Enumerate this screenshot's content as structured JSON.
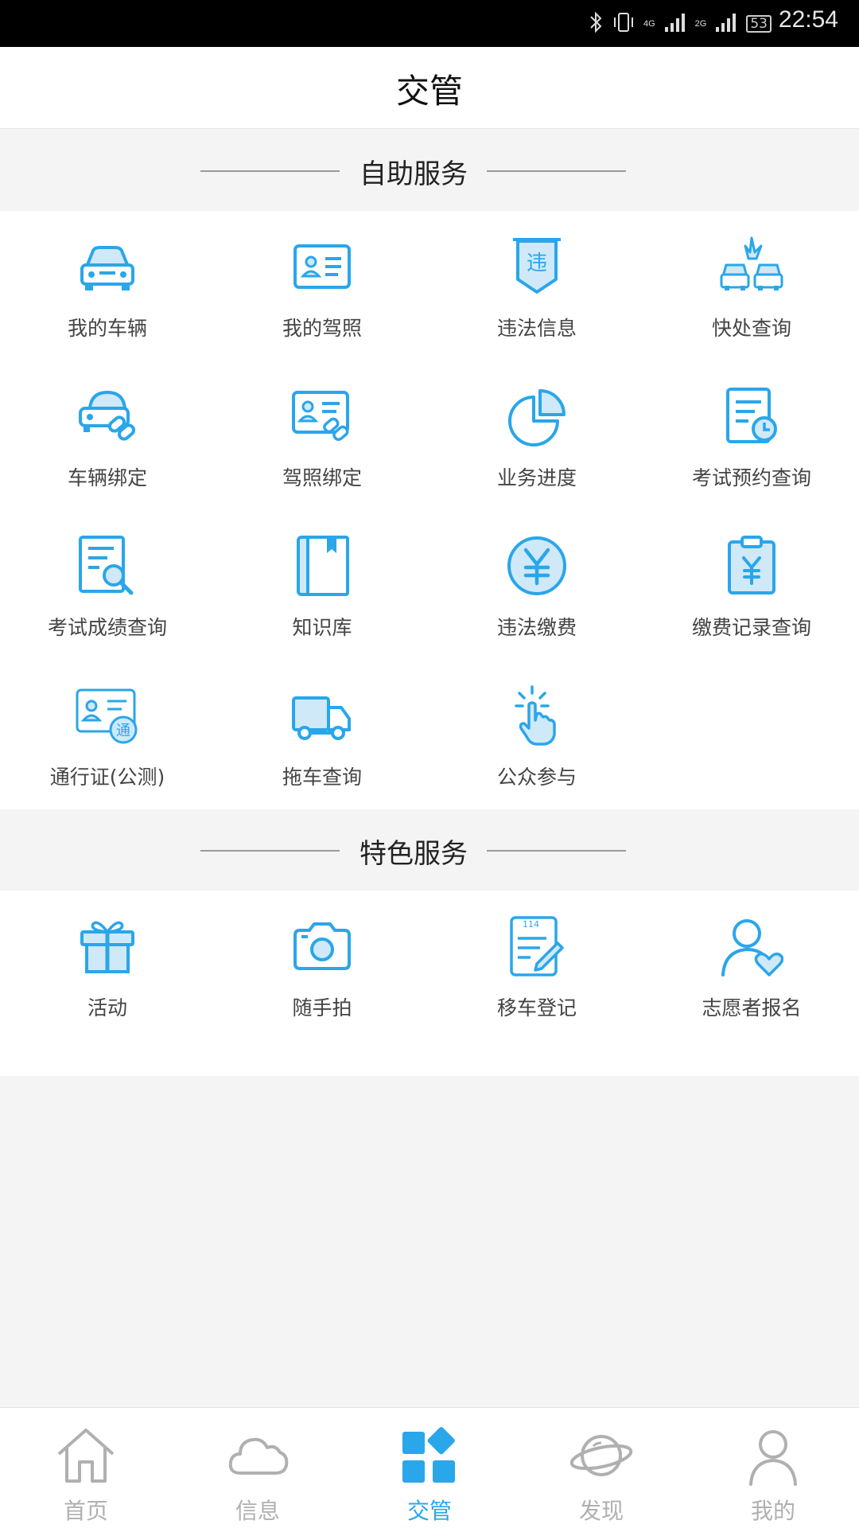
{
  "status_bar": {
    "network_4g": "4G",
    "network_2g": "2G",
    "battery": "53",
    "time": "22:54"
  },
  "app_bar": {
    "title": "交管"
  },
  "sections": {
    "self_service": {
      "title": "自助服务",
      "items": [
        {
          "label": "我的车辆",
          "icon": "car-icon"
        },
        {
          "label": "我的驾照",
          "icon": "license-card-icon"
        },
        {
          "label": "违法信息",
          "icon": "violation-badge-icon"
        },
        {
          "label": "快处查询",
          "icon": "car-collision-icon"
        },
        {
          "label": "车辆绑定",
          "icon": "car-link-icon"
        },
        {
          "label": "驾照绑定",
          "icon": "license-link-icon"
        },
        {
          "label": "业务进度",
          "icon": "pie-chart-icon"
        },
        {
          "label": "考试预约查询",
          "icon": "document-clock-icon"
        },
        {
          "label": "考试成绩查询",
          "icon": "document-search-icon"
        },
        {
          "label": "知识库",
          "icon": "book-icon"
        },
        {
          "label": "违法缴费",
          "icon": "yuan-coin-icon"
        },
        {
          "label": "缴费记录查询",
          "icon": "clipboard-yuan-icon"
        },
        {
          "label": "通行证(公测)",
          "icon": "pass-card-icon",
          "badge": "通"
        },
        {
          "label": "拖车查询",
          "icon": "tow-truck-icon"
        },
        {
          "label": "公众参与",
          "icon": "tap-hand-icon"
        }
      ]
    },
    "featured_service": {
      "title": "特色服务",
      "items": [
        {
          "label": "活动",
          "icon": "gift-icon"
        },
        {
          "label": "随手拍",
          "icon": "camera-icon"
        },
        {
          "label": "移车登记",
          "icon": "notepad-pen-icon",
          "badge": "114"
        },
        {
          "label": "志愿者报名",
          "icon": "volunteer-heart-icon"
        }
      ]
    }
  },
  "violation_badge_text": "违",
  "tab_bar": {
    "tabs": [
      {
        "label": "首页",
        "icon": "home-icon"
      },
      {
        "label": "信息",
        "icon": "cloud-icon"
      },
      {
        "label": "交管",
        "icon": "grid-apps-icon",
        "active": true
      },
      {
        "label": "发现",
        "icon": "planet-icon"
      },
      {
        "label": "我的",
        "icon": "person-icon"
      }
    ]
  },
  "colors": {
    "accent": "#2aa6ea",
    "icon_fill": "#cfe9f8",
    "tab_inactive": "#b0b0b0",
    "background": "#f4f4f4"
  }
}
